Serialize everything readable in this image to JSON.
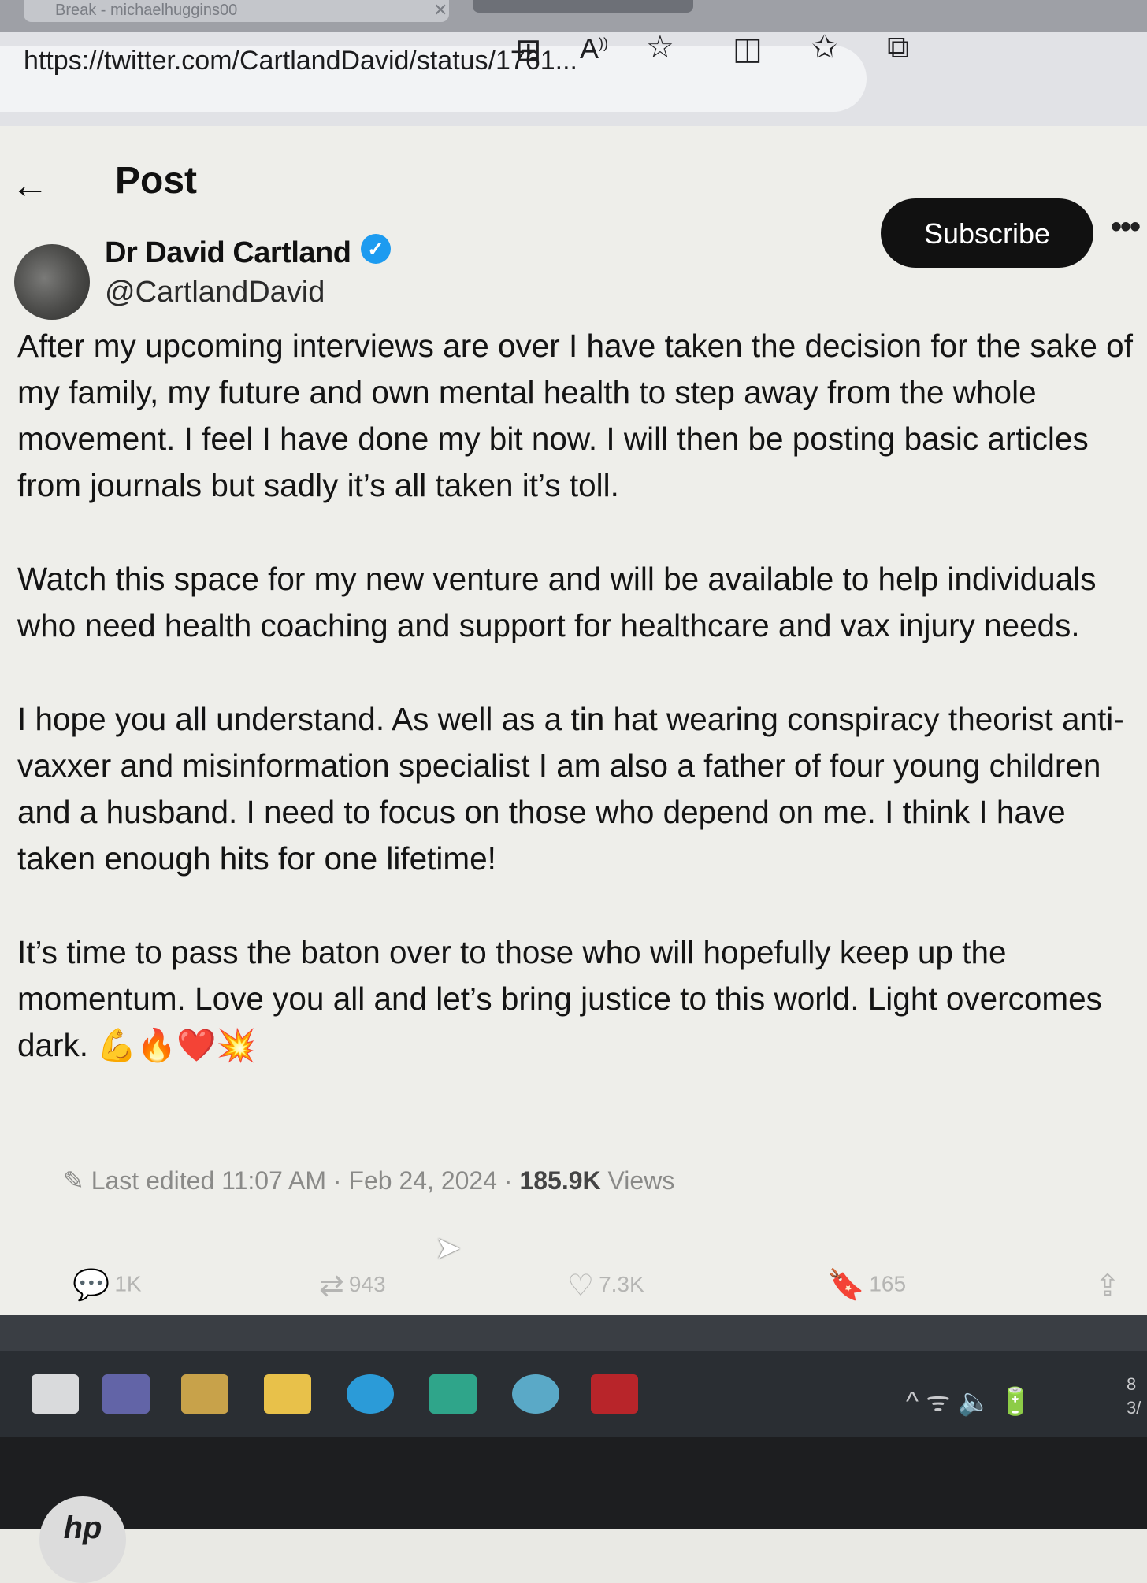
{
  "browser": {
    "tab_title": "Break - michaelhuggins00",
    "tab_close": "✕",
    "url": "https://twitter.com/CartlandDavid/status/1761..."
  },
  "page": {
    "back_icon": "←",
    "title": "Post"
  },
  "author": {
    "name": "Dr David Cartland",
    "verified_icon": "✓",
    "handle": "@CartlandDavid"
  },
  "header_actions": {
    "subscribe_label": "Subscribe",
    "more_label": "•••"
  },
  "post": {
    "paragraphs": [
      "After my upcoming interviews are over I have taken the decision for the sake of my family, my future and own mental health to step away from the whole movement.  I feel I have done my bit now.  I will then be posting basic articles from journals but sadly it’s all taken it’s toll.",
      "Watch this space for my new venture and will be available to help individuals who need health coaching and support for healthcare and vax injury needs.",
      "I hope you all understand. As well as a tin hat wearing conspiracy theorist anti-vaxxer and misinformation specialist I am also a father of four young children and a husband.  I need to focus on those who depend on me.  I think I have taken enough hits for one lifetime!",
      "It’s time to pass the baton over to those who will hopefully keep up the momentum.  Love you all and let’s bring justice to this world. Light overcomes dark. 💪🔥❤️💥"
    ],
    "edited_icon": "✎",
    "last_edited": "Last edited 11:07 AM · Feb 24, 2024 · ",
    "views_count": "185.9K",
    "views_label": " Views"
  },
  "actions": {
    "replies": "1K",
    "reposts": "943",
    "likes": "7.3K",
    "bookmarks": "165",
    "reply_icon": "💬",
    "repost_icon": "⇄",
    "like_icon": "♡",
    "bookmark_icon": "🔖",
    "share_icon": "⇪"
  },
  "taskbar": {
    "tray": "^  ᯤ 🔈 🔋",
    "clock_time": "8",
    "clock_date": "3/"
  },
  "colors": {
    "verified": "#1d9bf0",
    "subscribe_bg": "#111111",
    "taskbar": "#2a2e33"
  }
}
